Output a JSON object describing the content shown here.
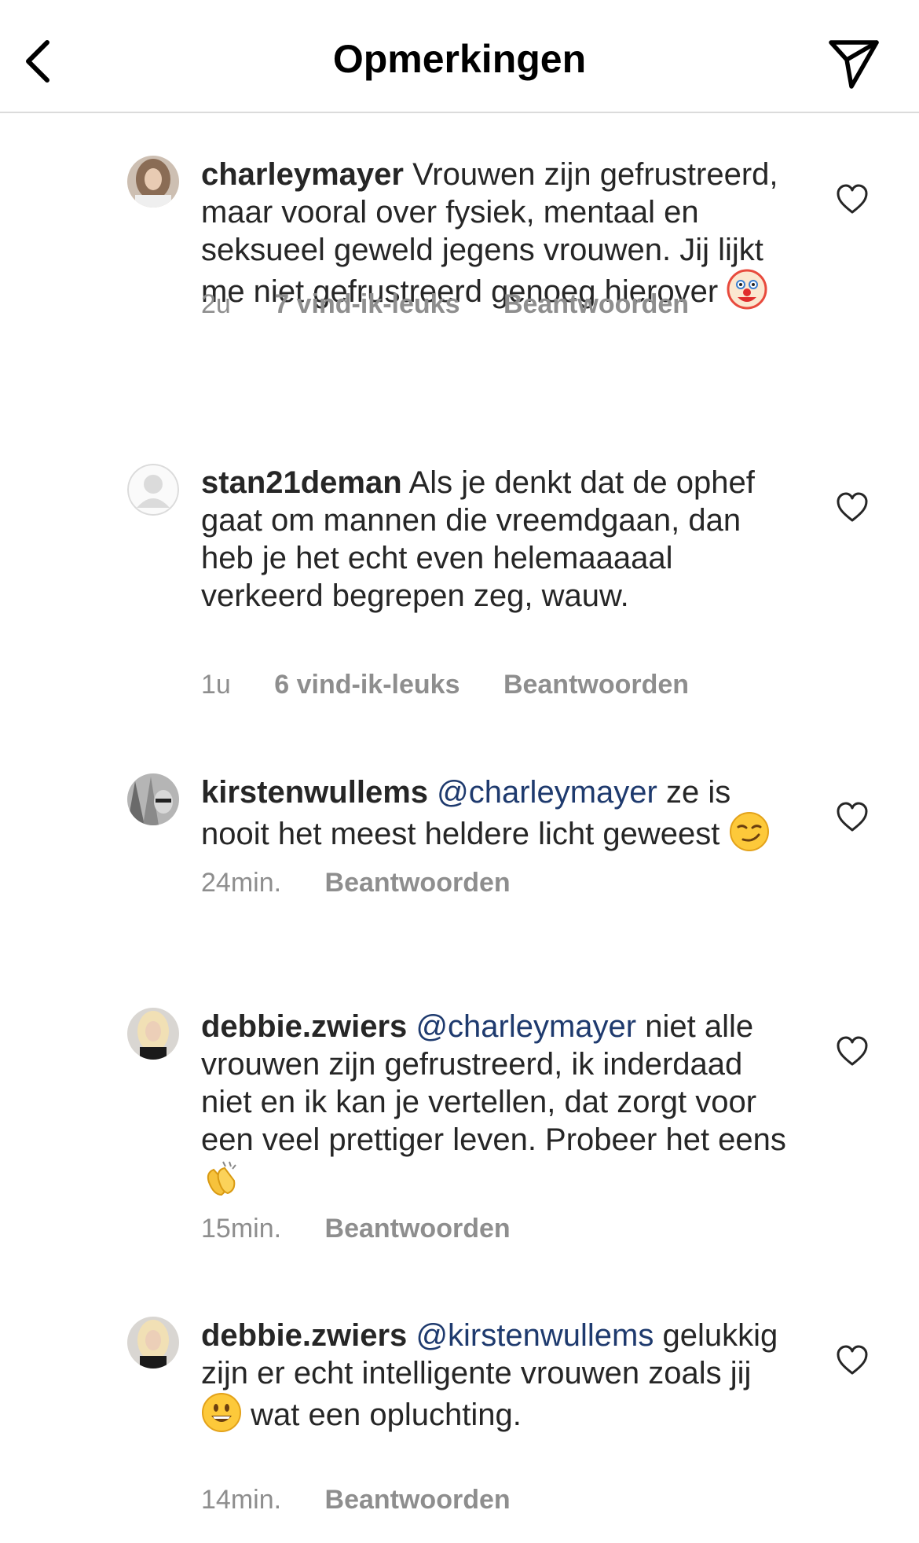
{
  "header": {
    "title": "Opmerkingen"
  },
  "comments": [
    {
      "username": "charleymayer",
      "mention": "",
      "text": "Vrouwen zijn gefrustreerd, maar vooral over fysiek, mentaal en seksueel geweld jegens vrouwen. Jij lijkt me niet gefrustreerd genoeg hierover",
      "emoji": "clown-face",
      "time": "2u",
      "likes": "7 vind-ik-leuks",
      "reply": "Beantwoorden"
    },
    {
      "username": "stan21deman",
      "mention": "",
      "text": "Als je denkt dat de ophef gaat om mannen die vreemdgaan, dan heb je het echt even helemaaaaal verkeerd begrepen zeg, wauw.",
      "emoji": "",
      "time": "1u",
      "likes": "6 vind-ik-leuks",
      "reply": "Beantwoorden"
    },
    {
      "username": "kirstenwullems",
      "mention": "@charleymayer",
      "text": "ze is nooit het meest heldere licht geweest",
      "emoji": "smirking-face",
      "time": "24min.",
      "likes": "",
      "reply": "Beantwoorden"
    },
    {
      "username": "debbie.zwiers",
      "mention": "@charleymayer",
      "text": "niet alle vrouwen zijn gefrustreerd, ik inderdaad niet en ik kan je vertellen, dat zorgt voor een veel prettiger leven. Probeer het eens",
      "emoji": "clapping-hands",
      "time": "15min.",
      "likes": "",
      "reply": "Beantwoorden"
    },
    {
      "username": "debbie.zwiers",
      "mention": "@kirstenwullems",
      "text_before": "gelukkig zijn er echt intelligente vrouwen zoals jij",
      "emoji": "grinning-face",
      "text_after": "wat een opluchting.",
      "time": "14min.",
      "likes": "",
      "reply": "Beantwoorden"
    }
  ],
  "colors": {
    "text": "#262626",
    "meta": "#8e8e8e",
    "mention": "#1e3a6e",
    "divider": "#dbdbdb"
  }
}
